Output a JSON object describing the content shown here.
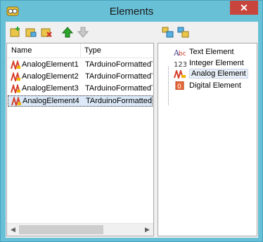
{
  "window": {
    "title": "Elements",
    "close_label": "✕"
  },
  "toolbar": {
    "left": [
      {
        "name": "add-element-icon"
      },
      {
        "name": "add-folder-icon"
      },
      {
        "name": "delete-element-icon"
      },
      {
        "name": "move-up-icon"
      },
      {
        "name": "move-down-icon"
      }
    ],
    "right": [
      {
        "name": "expand-tree-icon"
      },
      {
        "name": "collapse-tree-icon"
      }
    ]
  },
  "list": {
    "columns": [
      "Name",
      "Type"
    ],
    "rows": [
      {
        "name": "AnalogElement1",
        "type": "TArduinoFormattedTextElementAnalog"
      },
      {
        "name": "AnalogElement2",
        "type": "TArduinoFormattedTextElementAnalog"
      },
      {
        "name": "AnalogElement3",
        "type": "TArduinoFormattedTextElementAnalog"
      },
      {
        "name": "AnalogElement4",
        "type": "TArduinoFormattedTextElementAnalog"
      }
    ],
    "selected_index": 3
  },
  "palette": {
    "items": [
      {
        "label": "Text Element",
        "icon": "text-element-icon"
      },
      {
        "label": "Integer Element",
        "icon": "integer-element-icon"
      },
      {
        "label": "Analog Element",
        "icon": "analog-element-icon"
      },
      {
        "label": "Digital Element",
        "icon": "digital-element-icon"
      }
    ],
    "selected_index": 2
  },
  "colors": {
    "titlebar": "#68c0d6",
    "close": "#c7453c",
    "selection": "#dbe9f8"
  }
}
